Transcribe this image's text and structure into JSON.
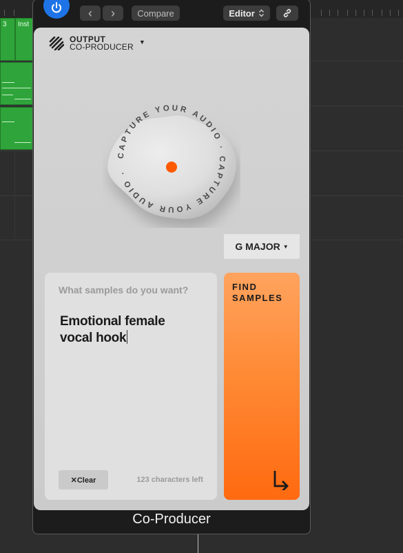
{
  "daw": {
    "region_labels": [
      "3",
      "Inst"
    ]
  },
  "toolbar": {
    "back_icon": "‹",
    "forward_icon": "›",
    "compare_label": "Compare",
    "editor_label": "Editor",
    "editor_caret": "⌃⌄",
    "link_icon": "link-icon"
  },
  "plugin": {
    "brand_line1": "OUTPUT",
    "brand_line2": "CO-PRODUCER",
    "brand_caret": "▼",
    "capture_text": "CAPTURE YOUR AUDIO · CAPTURE YOUR AUDIO ·",
    "key_label": "G MAJOR",
    "key_caret": "▼",
    "prompt_placeholder": "What samples do you want?",
    "prompt_value": "Emotional female vocal hook",
    "clear_label": "✕Clear",
    "chars_left": "123 characters left",
    "find_label": "FIND SAMPLES",
    "window_title": "Co-Producer"
  },
  "colors": {
    "accent_orange": "#ff6a10",
    "power_blue": "#1e74e6",
    "region_green": "#2fa43a",
    "record_dot": "#ff5a00"
  }
}
